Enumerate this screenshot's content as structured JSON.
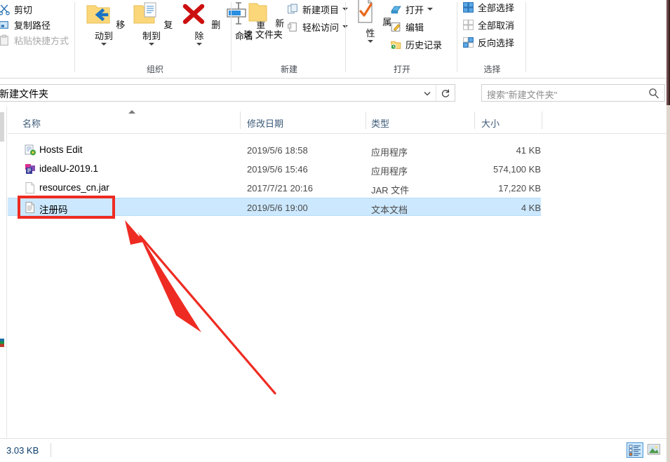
{
  "ribbon": {
    "groups": [
      {
        "name": "clipboard",
        "label": ""
      },
      {
        "name": "organize",
        "label": "组织"
      },
      {
        "name": "new",
        "label": "新建"
      },
      {
        "name": "open",
        "label": "打开"
      },
      {
        "name": "select",
        "label": "选择"
      }
    ],
    "clipboard": {
      "items": [
        {
          "label": "剪切",
          "icon": "scissors-icon",
          "disabled": false
        },
        {
          "label": "复制路径",
          "icon": "copy-path-icon",
          "disabled": false
        },
        {
          "label": "粘贴快捷方式",
          "icon": "paste-shortcut-icon",
          "disabled": true
        }
      ]
    },
    "organize": {
      "label": "组织",
      "items": [
        {
          "label": "移动到",
          "icon": "move-to-icon",
          "has_dropdown": true
        },
        {
          "label": "复制到",
          "icon": "copy-to-icon",
          "has_dropdown": true
        },
        {
          "label": "删除",
          "icon": "delete-icon",
          "has_dropdown": true
        },
        {
          "label": "重命名",
          "icon": "rename-icon",
          "has_dropdown": false
        }
      ]
    },
    "new": {
      "label": "新建",
      "big": {
        "label": "新建",
        "label2": "文件夹",
        "icon": "new-folder-icon"
      },
      "items": [
        {
          "label": "新建项目",
          "icon": "new-item-icon",
          "has_dropdown": true
        },
        {
          "label": "轻松访问",
          "icon": "easy-access-icon",
          "has_dropdown": true
        }
      ]
    },
    "open": {
      "label": "打开",
      "big": {
        "label": "属性",
        "icon": "properties-icon",
        "has_dropdown": true
      },
      "items": [
        {
          "label": "打开",
          "icon": "open-icon",
          "has_dropdown": true
        },
        {
          "label": "编辑",
          "icon": "edit-icon",
          "has_dropdown": false
        },
        {
          "label": "历史记录",
          "icon": "history-icon",
          "has_dropdown": false
        }
      ]
    },
    "select": {
      "label": "选择",
      "items": [
        {
          "label": "全部选择",
          "icon": "select-all-icon",
          "disabled": false
        },
        {
          "label": "全部取消",
          "icon": "select-none-icon",
          "disabled": true
        },
        {
          "label": "反向选择",
          "icon": "invert-selection-icon",
          "disabled": false
        }
      ]
    }
  },
  "navbar": {
    "address_value": "新建文件夹",
    "dropdown_icon": "chevron-down-icon",
    "refresh_icon": "refresh-icon",
    "search_placeholder": "搜索\"新建文件夹\"",
    "search_value": "",
    "search_icon": "search-icon"
  },
  "filelist": {
    "columns": [
      {
        "label": "名称",
        "key": "name"
      },
      {
        "label": "修改日期",
        "key": "date"
      },
      {
        "label": "类型",
        "key": "type"
      },
      {
        "label": "大小",
        "key": "size"
      }
    ],
    "sort_column": "名称",
    "sort_direction": "ascending",
    "rows": [
      {
        "name": "Hosts Edit",
        "date": "2019/5/6 18:58",
        "type": "应用程序",
        "size": "41 KB",
        "icon": "application-icon",
        "selected": false
      },
      {
        "name": "idealU-2019.1",
        "date": "2019/5/6 15:46",
        "type": "应用程序",
        "size": "574,100 KB",
        "icon": "installer-icon",
        "selected": false
      },
      {
        "name": "resources_cn.jar",
        "date": "2017/7/21 20:16",
        "type": "JAR 文件",
        "size": "17,220 KB",
        "icon": "blank-file-icon",
        "selected": false
      },
      {
        "name": "注册码",
        "date": "2019/5/6 19:00",
        "type": "文本文档",
        "size": "4 KB",
        "icon": "text-file-icon",
        "selected": true
      }
    ]
  },
  "statusbar": {
    "text": "3.03 KB",
    "views": [
      {
        "name": "details-view",
        "icon": "details-view-icon",
        "active": true
      },
      {
        "name": "large-icons-view",
        "icon": "large-icons-view-icon",
        "active": false
      }
    ]
  },
  "annotations": {
    "highlight_box": {
      "color": "#ee2b22",
      "target": "注册码"
    },
    "arrow": {
      "color": "#ee2b22",
      "points_to": "注册码"
    }
  },
  "colors": {
    "selection": "#cce8ff",
    "annotation": "#ee2b22",
    "header_text": "#3c5a78"
  }
}
